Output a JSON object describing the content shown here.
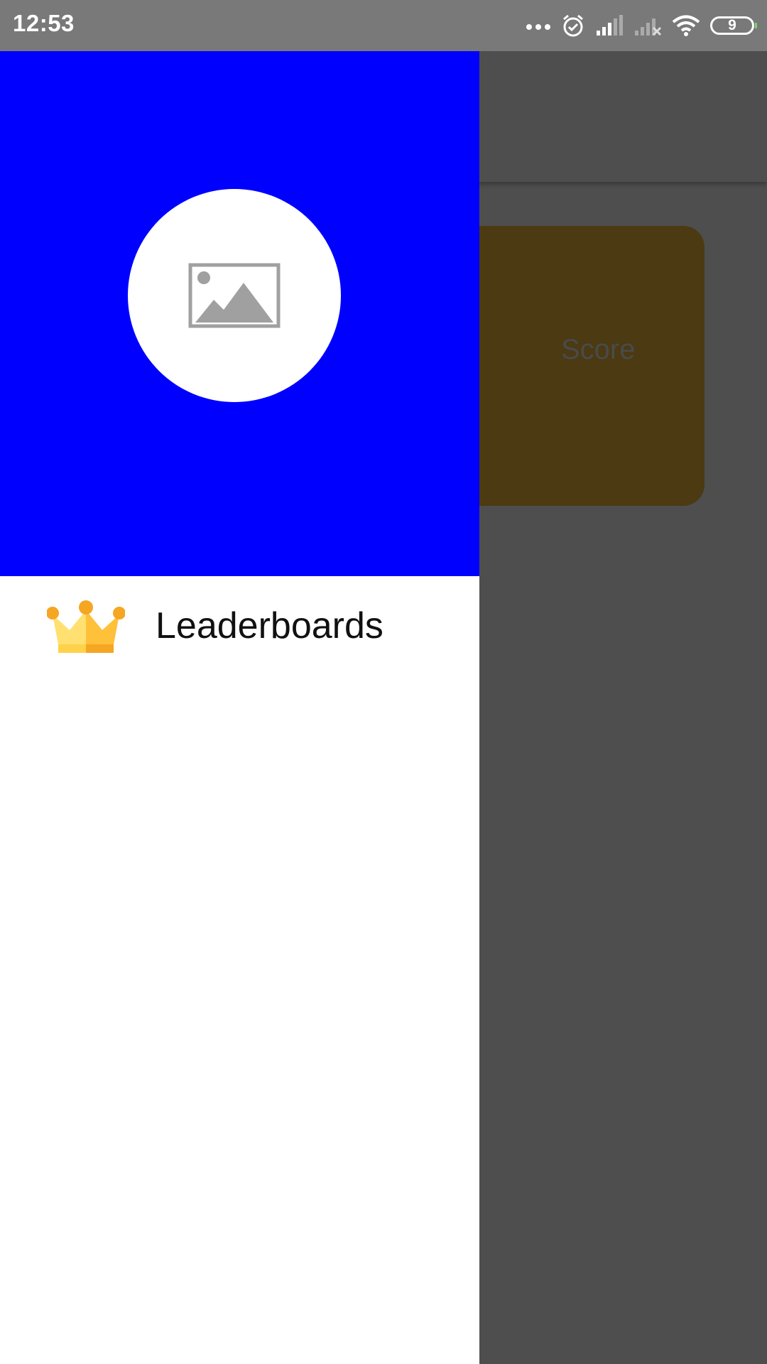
{
  "status_bar": {
    "time": "12:53",
    "battery_level": "9",
    "icons": [
      "more-dots-icon",
      "alarm-icon",
      "signal-icon",
      "signal-off-icon",
      "wifi-icon",
      "battery-icon"
    ]
  },
  "background_app": {
    "score_label": "Score"
  },
  "drawer": {
    "header": {
      "background_color": "#0000ff",
      "avatar_icon": "image-placeholder-icon"
    },
    "items": [
      {
        "icon": "crown-icon",
        "label": "Leaderboards"
      }
    ]
  }
}
